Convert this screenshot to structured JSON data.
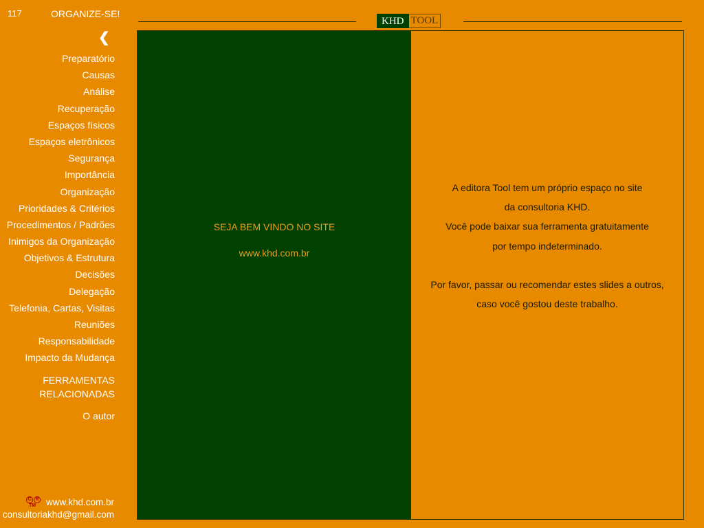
{
  "header": {
    "page_number": "117",
    "title": "ORGANIZE-SE!",
    "back_arrow": "❮",
    "logo": {
      "left": "KHD",
      "right": "TOOL"
    }
  },
  "nav": {
    "items": [
      "Preparatório",
      "Causas",
      "Análise",
      "Recuperação",
      "Espaços físicos",
      "Espaços eletrônicos",
      "Segurança",
      "Importância",
      "Organização",
      "Prioridades & Critérios",
      "Procedimentos / Padrões",
      "Inimigos da Organização",
      "Objetivos & Estrutura",
      "Decisões",
      "Delegação",
      "Telefonia, Cartas, Visitas",
      "Reuniões",
      "Responsabilidade",
      "Impacto da Mudança"
    ],
    "tools_line1": "FERRAMENTAS",
    "tools_line2": "RELACIONADAS",
    "author": "O autor"
  },
  "footer": {
    "trademark": {
      "c": "C",
      "r": "R",
      "tm": "TM"
    },
    "website": "www.khd.com.br",
    "email": "consultoriakhd@gmail.com"
  },
  "main": {
    "welcome": "SEJA BEM VINDO NO SITE",
    "url": "www.khd.com.br",
    "lines": [
      "A  editora Tool tem um próprio espaço no site",
      "da consultoria KHD.",
      "Você pode baixar sua ferramenta gratuitamente",
      "por tempo indeterminado.",
      "",
      "Por favor, passar ou recomendar estes slides a outros,",
      "caso você gostou deste trabalho."
    ]
  },
  "colors": {
    "background": "#e88a00",
    "panel": "#004000",
    "panel_text": "#e8a020"
  }
}
